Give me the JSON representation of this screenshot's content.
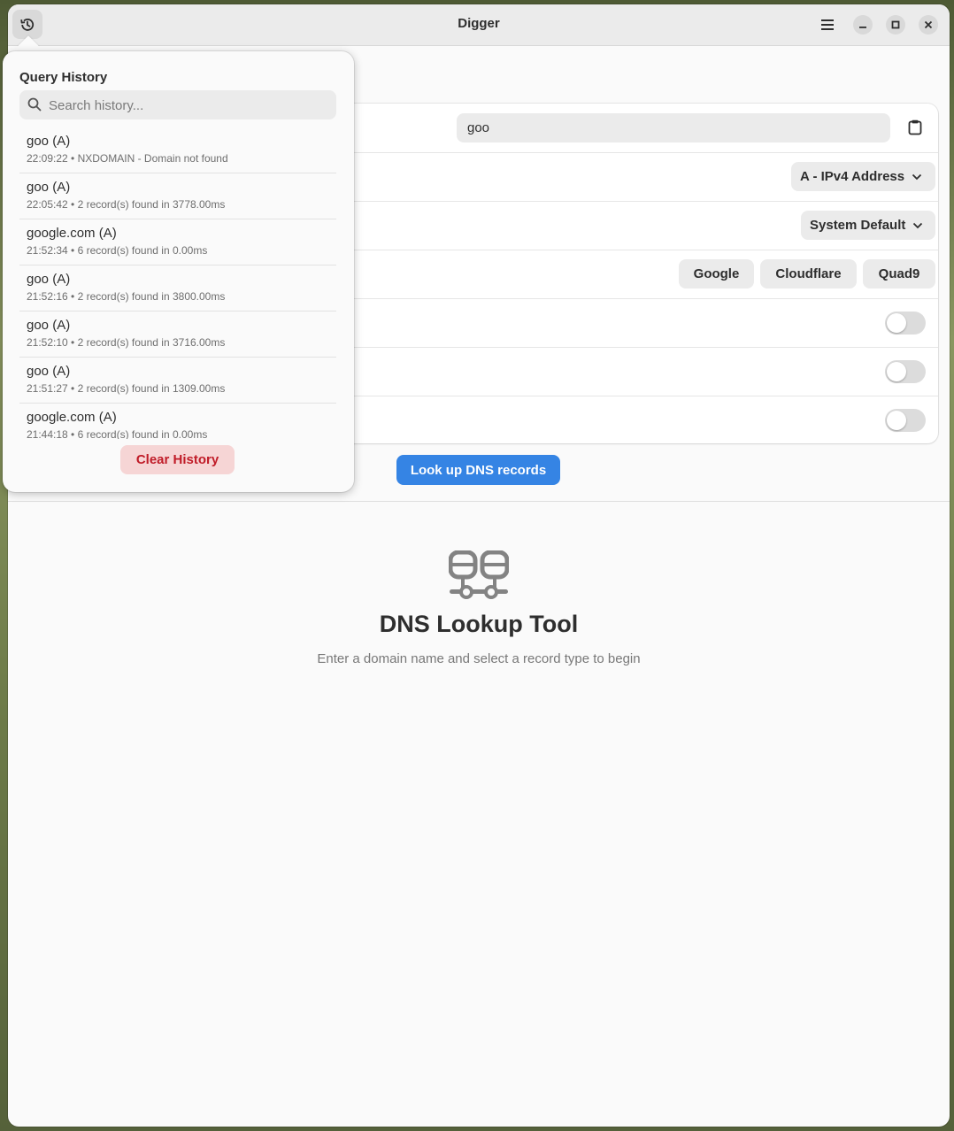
{
  "window": {
    "title": "Digger"
  },
  "form": {
    "domain_value": "goo",
    "record_type": "A - IPv4 Address",
    "dns_server": "System Default",
    "quick_servers": [
      "Google",
      "Cloudflare",
      "Quad9"
    ],
    "toggles": [
      false,
      false,
      false
    ],
    "lookup_label": "Look up DNS records"
  },
  "status": {
    "title": "DNS Lookup Tool",
    "description": "Enter a domain name and select a record type to begin"
  },
  "history": {
    "title": "Query History",
    "search_placeholder": "Search history...",
    "items": [
      {
        "query": "goo (A)",
        "detail": "22:09:22 • NXDOMAIN - Domain not found"
      },
      {
        "query": "goo (A)",
        "detail": "22:05:42 • 2 record(s) found in 3778.00ms"
      },
      {
        "query": "google.com (A)",
        "detail": "21:52:34 • 6 record(s) found in 0.00ms"
      },
      {
        "query": "goo (A)",
        "detail": "21:52:16 • 2 record(s) found in 3800.00ms"
      },
      {
        "query": "goo (A)",
        "detail": "21:52:10 • 2 record(s) found in 3716.00ms"
      },
      {
        "query": "goo (A)",
        "detail": "21:51:27 • 2 record(s) found in 1309.00ms"
      },
      {
        "query": "google.com (A)",
        "detail": "21:44:18 • 6 record(s) found in 0.00ms"
      }
    ],
    "clear_label": "Clear History"
  },
  "colors": {
    "accent": "#3584e4",
    "destructive": "#c01c28"
  }
}
